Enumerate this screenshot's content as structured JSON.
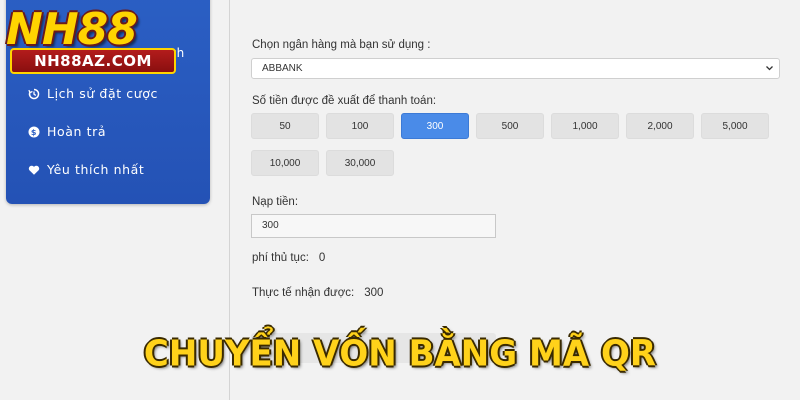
{
  "logo": {
    "main": "NH88",
    "sub": "NH88AZ.COM"
  },
  "sidebar": {
    "partial_label": "ch",
    "items": [
      {
        "label": "Lịch sử đặt cược",
        "icon": "history-icon"
      },
      {
        "label": "Hoàn trả",
        "icon": "refund-icon"
      },
      {
        "label": "Yêu thích nhất",
        "icon": "heart-icon"
      }
    ]
  },
  "form": {
    "bank_label": "Chọn ngân hàng mà bạn sử dụng :",
    "bank_selected": "ABBANK",
    "suggest_label": "Số tiền được đề xuất để thanh toán:",
    "amounts": [
      "50",
      "100",
      "300",
      "500",
      "1,000",
      "2,000",
      "5,000",
      "10,000",
      "30,000"
    ],
    "active_amount": "300",
    "deposit_label": "Nạp tiền:",
    "deposit_value": "300",
    "fee_label": "phí thủ tục:",
    "fee_value": "0",
    "received_label": "Thực tế nhận được:",
    "received_value": "300"
  },
  "banner": {
    "text": "CHUYỂN VỐN BẰNG MÃ QR"
  },
  "colors": {
    "sidebar": "#2b5fc4",
    "active": "#4a8be8",
    "banner": "#ffd21a"
  }
}
